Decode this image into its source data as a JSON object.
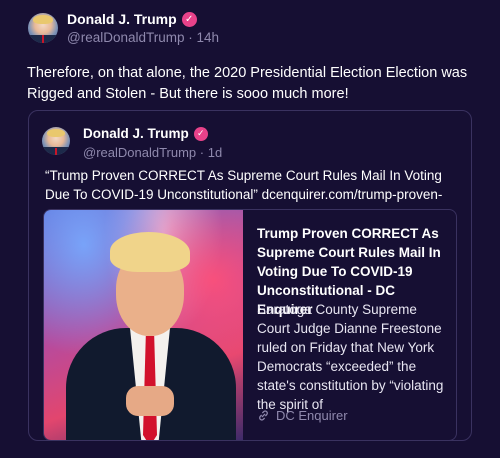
{
  "post": {
    "author_name": "Donald J. Trump",
    "handle": "@realDonaldTrump",
    "separator": "·",
    "time": "14h",
    "text": "Therefore, on that alone, the 2020 Presidential Election Election was Rigged and Stolen - But there is sooo much more!",
    "verified_icon": "verified-badge-icon",
    "avatar_icon": "avatar-image"
  },
  "quoted_post": {
    "author_name": "Donald J. Trump",
    "handle": "@realDonaldTrump",
    "separator": "·",
    "time": "1d",
    "text": "“Trump Proven CORRECT As Supreme Court Rules Mail In Voting Due To COVID-19 Unconstitutional” dcenquirer.com/trump-proven-co..."
  },
  "link_card": {
    "title": "Trump Proven CORRECT As Supreme Court Rules Mail In Voting Due To COVID-19 Unconstitutional - DC Enquirer",
    "description": "Saratoga County Supreme Court Judge Dianne Freestone ruled on Friday that New York Democrats “exceeded” the state's constitution by “violating the spirit of",
    "source": "DC Enquirer",
    "source_icon": "link-icon"
  },
  "colors": {
    "background": "#160f33",
    "border": "#3a3260",
    "muted_text": "#8f89ad",
    "verified_badge": "#e8428a"
  }
}
